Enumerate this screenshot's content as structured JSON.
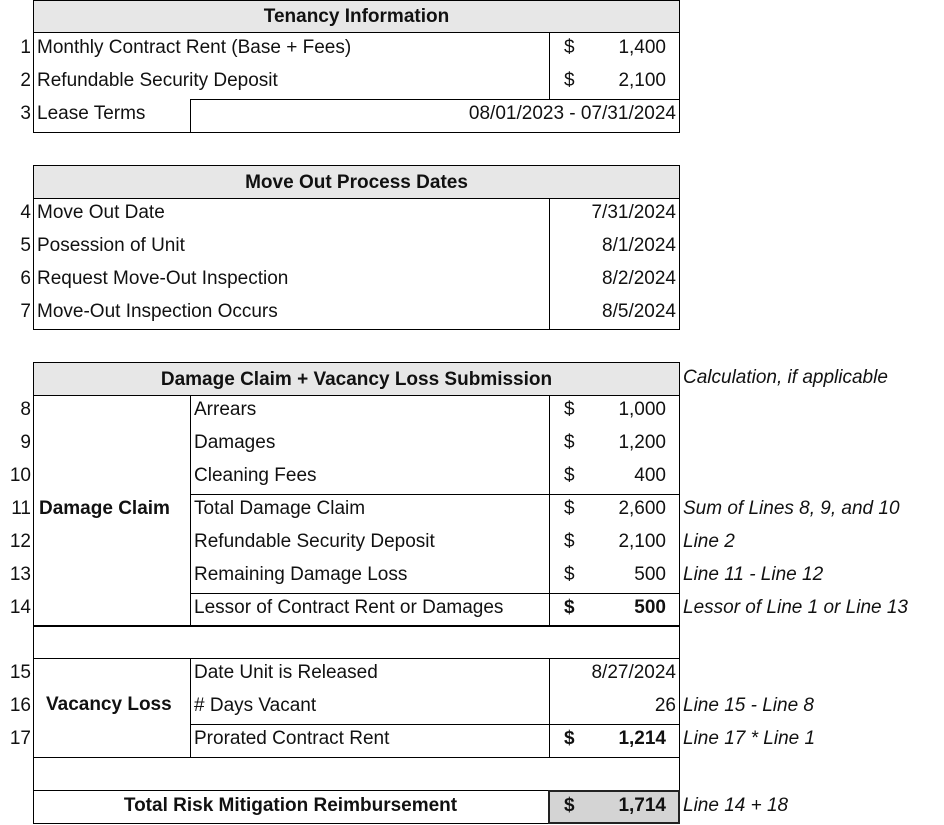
{
  "tenancy": {
    "title": "Tenancy Information",
    "rows": [
      {
        "num": "1",
        "label": "Monthly Contract Rent (Base + Fees)",
        "currency": "$",
        "value": "1,400"
      },
      {
        "num": "2",
        "label": "Refundable Security Deposit",
        "currency": "$",
        "value": "2,100"
      },
      {
        "num": "3",
        "label": "Lease Terms",
        "value": "08/01/2023 - 07/31/2024"
      }
    ]
  },
  "moveout": {
    "title": "Move Out Process Dates",
    "rows": [
      {
        "num": "4",
        "label": "Move Out Date",
        "value": "7/31/2024"
      },
      {
        "num": "5",
        "label": "Posession of Unit",
        "value": "8/1/2024"
      },
      {
        "num": "6",
        "label": "Request Move-Out Inspection",
        "value": "8/2/2024"
      },
      {
        "num": "7",
        "label": "Move-Out Inspection Occurs",
        "value": "8/5/2024"
      }
    ]
  },
  "claim": {
    "title": "Damage Claim + Vacancy Loss Submission",
    "calc_header": "Calculation, if applicable",
    "damage_group_label": "Damage Claim",
    "damage_rows": [
      {
        "num": "8",
        "label": "Arrears",
        "currency": "$",
        "value": "1,000",
        "note": ""
      },
      {
        "num": "9",
        "label": "Damages",
        "currency": "$",
        "value": "1,200",
        "note": ""
      },
      {
        "num": "10",
        "label": "Cleaning Fees",
        "currency": "$",
        "value": "400",
        "note": ""
      },
      {
        "num": "11",
        "label": "Total Damage Claim",
        "currency": "$",
        "value": "2,600",
        "note": "Sum of Lines 8, 9, and 10"
      },
      {
        "num": "12",
        "label": "Refundable Security Deposit",
        "currency": "$",
        "value": "2,100",
        "note": "Line 2"
      },
      {
        "num": "13",
        "label": "Remaining Damage Loss",
        "currency": "$",
        "value": "500",
        "note": "Line 11 - Line 12"
      },
      {
        "num": "14",
        "label": "Lessor of Contract Rent or Damages",
        "currency": "$",
        "value": "500",
        "note": "Lessor of Line 1 or Line 13"
      }
    ],
    "vacancy_group_label": "Vacancy Loss",
    "vacancy_rows": [
      {
        "num": "15",
        "label": "Date Unit is Released",
        "currency": "",
        "value": "8/27/2024",
        "note": ""
      },
      {
        "num": "16",
        "label": "# Days Vacant",
        "currency": "",
        "value": "26",
        "note": "Line 15 - Line 8"
      },
      {
        "num": "17",
        "label": "Prorated Contract Rent",
        "currency": "$",
        "value": "1,214",
        "note": "Line 17 * Line 1"
      }
    ],
    "total": {
      "label": "Total Risk Mitigation Reimbursement",
      "currency": "$",
      "value": "1,714",
      "note": "Line 14 + 18"
    }
  }
}
